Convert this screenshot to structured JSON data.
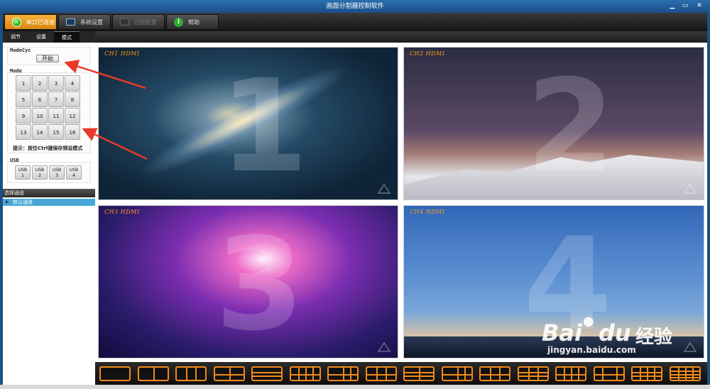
{
  "window": {
    "title": "画面分割器控制软件",
    "min": "▁",
    "max": "▭",
    "close": "✕"
  },
  "top_tabs": [
    {
      "label": "串口已连接"
    },
    {
      "label": "系统设置"
    },
    {
      "label": "远程配置"
    },
    {
      "label": "帮助"
    }
  ],
  "help_icon": "help-icon",
  "sub_tabs": [
    "调节",
    "设置",
    "模式"
  ],
  "mode_cyc": {
    "label": "ModeCyc",
    "start": "开始"
  },
  "mode": {
    "label": "Mode",
    "buttons": [
      "1",
      "2",
      "3",
      "4",
      "5",
      "6",
      "7",
      "8",
      "9",
      "10",
      "11",
      "12",
      "13",
      "14",
      "15",
      "16"
    ]
  },
  "hint": "提示：按住Ctrl键保存预设模式",
  "usb": {
    "label": "USB",
    "buttons": [
      {
        "l1": "USB",
        "l2": "1"
      },
      {
        "l1": "USB",
        "l2": "2"
      },
      {
        "l1": "USB",
        "l2": "3"
      },
      {
        "l1": "USB",
        "l2": "4"
      }
    ]
  },
  "channel_list": {
    "header": "选择通道",
    "item": "默认通道"
  },
  "channels": [
    {
      "label": "CH1   HDMI",
      "number": "1"
    },
    {
      "label": "CH2   HDMI",
      "number": "2"
    },
    {
      "label": "CH3   HDMI",
      "number": "3"
    },
    {
      "label": "CH4   HDMI",
      "number": "4"
    }
  ],
  "watermark": {
    "brand": "Bai",
    "brand2": "du",
    "brand_cn": "经验",
    "url": "jingyan.baidu.com"
  },
  "colors": {
    "accent": "#f08a1a",
    "channel_label": "#ff9a18",
    "selection": "#48a7d8"
  }
}
